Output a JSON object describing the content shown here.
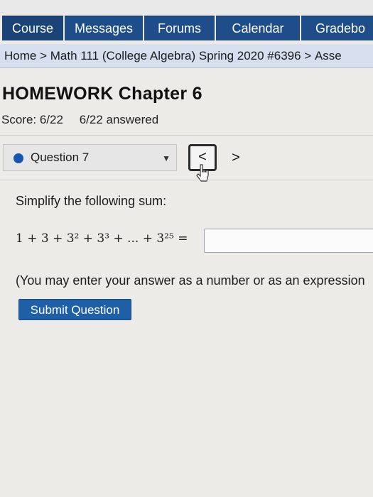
{
  "nav": {
    "tabs": [
      {
        "label": "Course"
      },
      {
        "label": "Messages"
      },
      {
        "label": "Forums"
      },
      {
        "label": "Calendar"
      },
      {
        "label": "Gradebo"
      }
    ]
  },
  "breadcrumb": {
    "home": "Home",
    "sep1": " > ",
    "course": "Math 111 (College Algebra) Spring 2020 #6396",
    "sep2": " > ",
    "current": "Asse"
  },
  "assignment": {
    "title": "HOMEWORK Chapter 6",
    "score": "Score: 6/22",
    "answered": "6/22 answered"
  },
  "question_nav": {
    "selected": "Question 7",
    "prev_symbol": "<",
    "next_symbol": ">"
  },
  "question": {
    "prompt": "Simplify the following sum:",
    "expression": "1 + 3 + 3² + 3³ + ... + 3²⁵ =",
    "answer_value": "",
    "note": "(You may enter your answer as a number or as an expression"
  },
  "actions": {
    "submit_label": "Submit Question"
  },
  "colors": {
    "tab_bg": "#1e4d8a",
    "breadcrumb_bg": "#d7dfee",
    "submit_bg": "#1e5fa6",
    "question_dot": "#1556b3"
  }
}
